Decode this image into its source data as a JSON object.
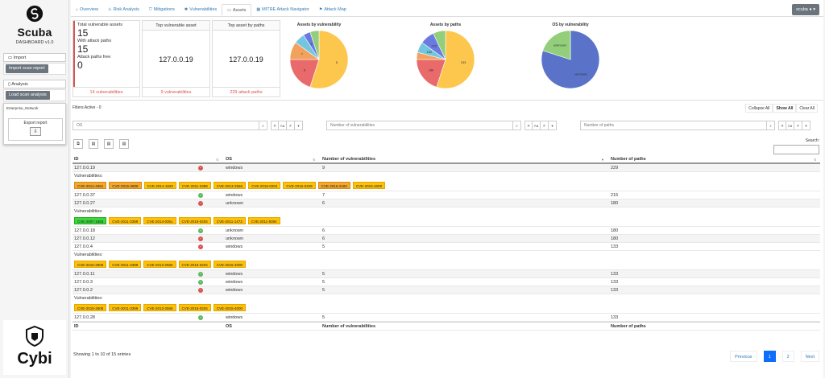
{
  "brand": {
    "name": "Scuba",
    "version": "DASHBOARD v1.0",
    "footer_name": "Cybi"
  },
  "sidebar": {
    "import_heading": "Import",
    "import_button": "Import scan report",
    "analysis_heading": "Analysis",
    "analysis_button": "Load scan analysis",
    "network_name": "Enterprise_Network",
    "export_label": "Export report"
  },
  "tabs": [
    {
      "label": "Overview",
      "icon": "home-icon"
    },
    {
      "label": "Risk Analysis",
      "icon": "risk-icon"
    },
    {
      "label": "Mitigations",
      "icon": "shield-icon"
    },
    {
      "label": "Vulnerabilities",
      "icon": "bug-icon"
    },
    {
      "label": "Assets",
      "icon": "assets-icon"
    },
    {
      "label": "MITRE Attack Navigator",
      "icon": "grid-icon"
    },
    {
      "label": "Attack Map",
      "icon": "map-icon"
    }
  ],
  "active_tab": "Assets",
  "user": {
    "name": "scuba"
  },
  "stats": {
    "total_label": "Total vulnerable assets",
    "total_value": "15",
    "paths_label": "With attack paths",
    "paths_value": "15",
    "free_label": "Attack paths free",
    "free_value": "0",
    "footer": "14 vulnerabilities"
  },
  "top_vuln": {
    "title": "Top vulnerable asset",
    "value": "127.0.0.19",
    "footer": "9 vulnerabilities"
  },
  "top_paths": {
    "title": "Top asset by paths",
    "value": "127.0.0.19",
    "footer": "229 attack paths"
  },
  "chart_data": [
    {
      "type": "pie",
      "title": "Assets by vulnerability",
      "slices": [
        {
          "label": "5",
          "value": 55,
          "color": "#fdc74d"
        },
        {
          "label": "6",
          "value": 20,
          "color": "#e96a6a"
        },
        {
          "label": "7",
          "value": 10,
          "color": "#f3a25d"
        },
        {
          "label": "",
          "value": 6,
          "color": "#72c6e0"
        },
        {
          "label": "9",
          "value": 4,
          "color": "#6a7be0"
        },
        {
          "label": "",
          "value": 5,
          "color": "#93cf7a"
        }
      ]
    },
    {
      "type": "pie",
      "title": "Assets by paths",
      "slices": [
        {
          "label": "133",
          "value": 55,
          "color": "#fdc74d"
        },
        {
          "label": "180",
          "value": 20,
          "color": "#e96a6a"
        },
        {
          "label": "",
          "value": 4,
          "color": "#f3a25d"
        },
        {
          "label": "180",
          "value": 6,
          "color": "#72c6e0"
        },
        {
          "label": "229",
          "value": 8,
          "color": "#6a7be0"
        },
        {
          "label": "",
          "value": 7,
          "color": "#93cf7a"
        }
      ]
    },
    {
      "type": "pie",
      "title": "OS by vulnerability",
      "slices": [
        {
          "label": "windows",
          "value": 80,
          "color": "#5a73c9"
        },
        {
          "label": "unknown",
          "value": 20,
          "color": "#93cf7a"
        }
      ]
    }
  ],
  "filters": {
    "active_label": "Filters Active - 0",
    "collapse": "Collapse All",
    "show": "Show All",
    "clear": "Clear All",
    "os_placeholder": "OS",
    "vuln_placeholder": "Number of vulnerabilities",
    "paths_placeholder": "Number of paths",
    "small_btns": [
      "✕",
      "Aa",
      "#",
      "▾"
    ]
  },
  "search_label": "Search:",
  "table": {
    "headers": [
      "ID",
      "OS",
      "Number of vulnerabilities",
      "Number of paths"
    ],
    "vuln_label": "Vulnerabilities:",
    "rows": [
      {
        "id": "127.0.0.19",
        "status": "bad",
        "os": "windows",
        "vulns": "9",
        "paths": "229",
        "cves": [
          [
            "CVE-2014-4061",
            "orange"
          ],
          [
            "CVE-2015-2808",
            "orange"
          ],
          [
            "CVE-2014-1820",
            "yellow"
          ],
          [
            "CVE-2011-3389",
            "yellow"
          ],
          [
            "CVE-2013-2566",
            "yellow"
          ],
          [
            "CVE-2015-0204",
            "yellow"
          ],
          [
            "CVE-2016-6329",
            "yellow"
          ],
          [
            "CVE-2016-2183",
            "orange"
          ],
          [
            "CVE-2015-4000",
            "yellow"
          ]
        ]
      },
      {
        "id": "127.0.0.37",
        "status": "good",
        "os": "windows",
        "vulns": "7",
        "paths": "215",
        "cves": []
      },
      {
        "id": "127.0.0.27",
        "status": "bad",
        "os": "unknown",
        "vulns": "6",
        "paths": "180",
        "cves": [
          [
            "CVE-2007-1883",
            "green"
          ],
          [
            "CVE-2011-3389",
            "yellow"
          ],
          [
            "CVE-2014-0351",
            "yellow"
          ],
          [
            "CVE-2015-0204",
            "yellow"
          ],
          [
            "CVE-2011-1473",
            "yellow"
          ],
          [
            "CVE-2011-5094",
            "yellow"
          ]
        ]
      },
      {
        "id": "127.0.0.18",
        "status": "good",
        "os": "unknown",
        "vulns": "6",
        "paths": "180",
        "cves": []
      },
      {
        "id": "127.0.0.12",
        "status": "bad",
        "os": "unknown",
        "vulns": "6",
        "paths": "180",
        "cves": []
      },
      {
        "id": "127.0.0.4",
        "status": "bad",
        "os": "windows",
        "vulns": "5",
        "paths": "133",
        "cves": [
          [
            "CVE-2015-2808",
            "yellow"
          ],
          [
            "CVE-2011-3389",
            "yellow"
          ],
          [
            "CVE-2013-2566",
            "yellow"
          ],
          [
            "CVE-2015-0204",
            "yellow"
          ],
          [
            "CVE-2015-4000",
            "yellow"
          ]
        ]
      },
      {
        "id": "127.0.0.11",
        "status": "good",
        "os": "windows",
        "vulns": "5",
        "paths": "133",
        "cves": []
      },
      {
        "id": "127.0.0.3",
        "status": "good",
        "os": "windows",
        "vulns": "5",
        "paths": "133",
        "cves": []
      },
      {
        "id": "127.0.0.2",
        "status": "bad",
        "os": "windows",
        "vulns": "5",
        "paths": "133",
        "cves": [
          [
            "CVE-2015-2808",
            "yellow"
          ],
          [
            "CVE-2011-3389",
            "yellow"
          ],
          [
            "CVE-2013-2566",
            "yellow"
          ],
          [
            "CVE-2015-0204",
            "yellow"
          ],
          [
            "CVE-2015-4000",
            "yellow"
          ]
        ]
      },
      {
        "id": "127.0.0.28",
        "status": "good",
        "os": "windows",
        "vulns": "5",
        "paths": "133",
        "cves": []
      }
    ]
  },
  "showing": "Showing 1 to 10 of 15 entries",
  "pagination": {
    "prev": "Previous",
    "pages": [
      "1",
      "2"
    ],
    "next": "Next"
  }
}
